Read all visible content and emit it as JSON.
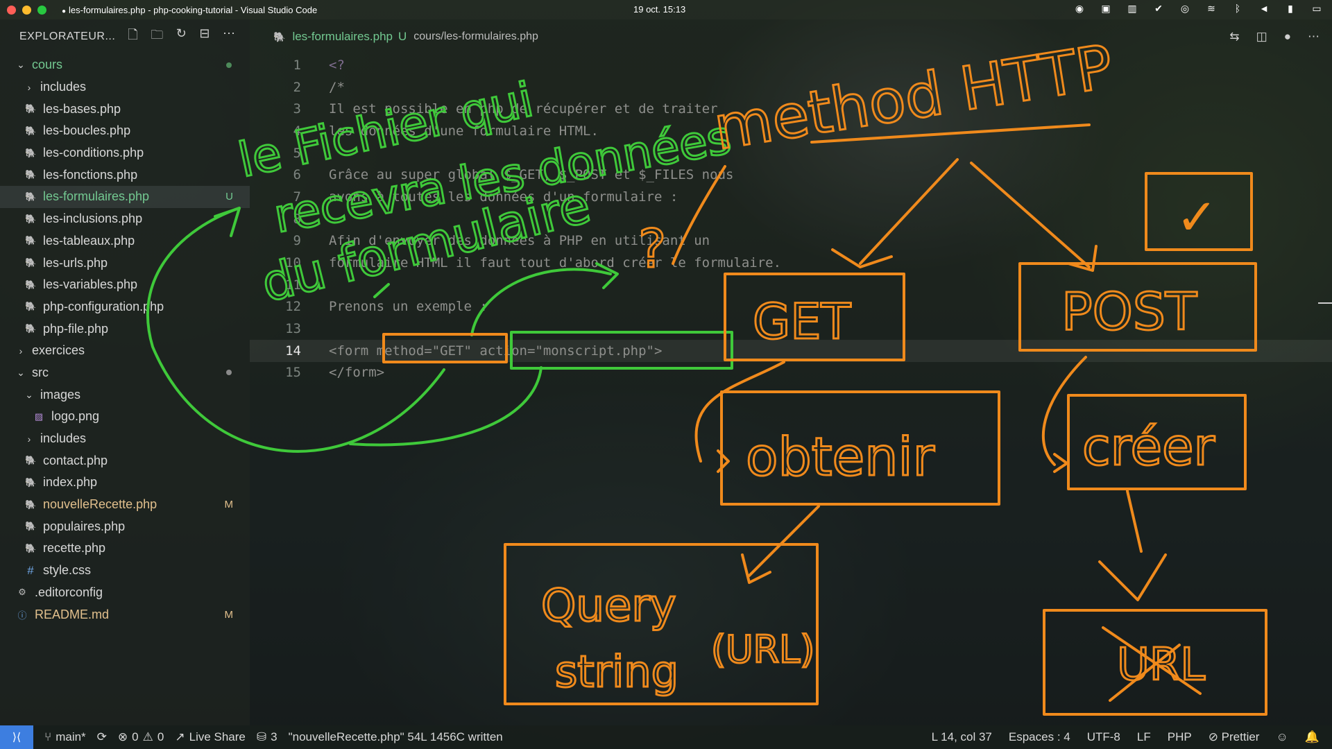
{
  "window": {
    "title": "les-formulaires.php - php-cooking-tutorial - Visual Studio Code",
    "datetime": "19 oct.  15:13"
  },
  "explorer": {
    "title": "EXPLORATEUR...",
    "tree": [
      {
        "label": "cours",
        "kind": "folder-open",
        "depth": 0,
        "color": "green",
        "badge": "dot-green"
      },
      {
        "label": "includes",
        "kind": "folder",
        "depth": 1
      },
      {
        "label": "les-bases.php",
        "kind": "php",
        "depth": 1
      },
      {
        "label": "les-boucles.php",
        "kind": "php",
        "depth": 1
      },
      {
        "label": "les-conditions.php",
        "kind": "php",
        "depth": 1
      },
      {
        "label": "les-fonctions.php",
        "kind": "php",
        "depth": 1
      },
      {
        "label": "les-formulaires.php",
        "kind": "php",
        "depth": 1,
        "color": "green",
        "badge": "U",
        "selected": true
      },
      {
        "label": "les-inclusions.php",
        "kind": "php",
        "depth": 1
      },
      {
        "label": "les-tableaux.php",
        "kind": "php",
        "depth": 1
      },
      {
        "label": "les-urls.php",
        "kind": "php",
        "depth": 1
      },
      {
        "label": "les-variables.php",
        "kind": "php",
        "depth": 1
      },
      {
        "label": "php-configuration.php",
        "kind": "php",
        "depth": 1
      },
      {
        "label": "php-file.php",
        "kind": "php",
        "depth": 1
      },
      {
        "label": "exercices",
        "kind": "folder",
        "depth": 0
      },
      {
        "label": "src",
        "kind": "folder-open",
        "depth": 0,
        "badge": "dot-grey"
      },
      {
        "label": "images",
        "kind": "folder-open",
        "depth": 1
      },
      {
        "label": "logo.png",
        "kind": "img",
        "depth": 2
      },
      {
        "label": "includes",
        "kind": "folder",
        "depth": 1
      },
      {
        "label": "contact.php",
        "kind": "php",
        "depth": 1
      },
      {
        "label": "index.php",
        "kind": "php",
        "depth": 1
      },
      {
        "label": "nouvelleRecette.php",
        "kind": "php",
        "depth": 1,
        "color": "gold",
        "badge": "M"
      },
      {
        "label": "populaires.php",
        "kind": "php",
        "depth": 1
      },
      {
        "label": "recette.php",
        "kind": "php",
        "depth": 1
      },
      {
        "label": "style.css",
        "kind": "css",
        "depth": 1
      },
      {
        "label": ".editorconfig",
        "kind": "cfg",
        "depth": 0
      },
      {
        "label": "README.md",
        "kind": "info",
        "depth": 0,
        "color": "gold",
        "badge": "M"
      }
    ]
  },
  "tab": {
    "name": "les-formulaires.php",
    "status": "U",
    "path": "cours/les-formulaires.php"
  },
  "editor": {
    "current_line": "14",
    "lines": [
      {
        "n": "1",
        "text": "<?",
        "cls": "kw"
      },
      {
        "n": "2",
        "text": "/*",
        "cls": ""
      },
      {
        "n": "3",
        "text": "Il est possible en php de récupérer et de traiter",
        "cls": ""
      },
      {
        "n": "4",
        "text": "les données d'une formulaire HTML.",
        "cls": ""
      },
      {
        "n": "5",
        "text": "",
        "cls": ""
      },
      {
        "n": "6",
        "text": "Grâce au super global $_GET, $_POST et $_FILES nous",
        "cls": ""
      },
      {
        "n": "7",
        "text": "avons à toutes les données d'un formulaire :",
        "cls": ""
      },
      {
        "n": "8",
        "text": "",
        "cls": ""
      },
      {
        "n": "9",
        "text": "Afin d'envoyer des données à PHP en utilisant un",
        "cls": ""
      },
      {
        "n": "10",
        "text": "formulaire HTML il faut tout d'abord créer le formulaire.",
        "cls": ""
      },
      {
        "n": "11",
        "text": "",
        "cls": ""
      },
      {
        "n": "12",
        "text": "Prenons un exemple :",
        "cls": ""
      },
      {
        "n": "13",
        "text": "",
        "cls": ""
      },
      {
        "n": "14",
        "text": "<form method=\"GET\" action=\"monscript.php\">",
        "cls": "tag"
      },
      {
        "n": "15",
        "text": "</form>",
        "cls": "tag"
      }
    ]
  },
  "statusbar": {
    "branch": "main*",
    "errors": "0",
    "warnings": "0",
    "live_share": "Live Share",
    "db_count": "3",
    "message": "\"nouvelleRecette.php\" 54L 1456C written",
    "position": "L 14, col 37",
    "spaces": "Espaces : 4",
    "encoding": "UTF-8",
    "eol": "LF",
    "language": "PHP",
    "formatter": "Prettier"
  },
  "annotations": {
    "green_note": [
      "le Fichier qui",
      "recevra les données",
      "du formulaire"
    ],
    "orange_title": "method HTTP",
    "get": "GET",
    "post": "POST",
    "obtenir": "obtenir",
    "creer": "créer",
    "query_string": [
      "Query",
      "string",
      "(URL)"
    ],
    "url": "URL",
    "check": "✓",
    "question": "?",
    "ink_green": "#3fc93a",
    "ink_orange": "#f08a1c"
  }
}
